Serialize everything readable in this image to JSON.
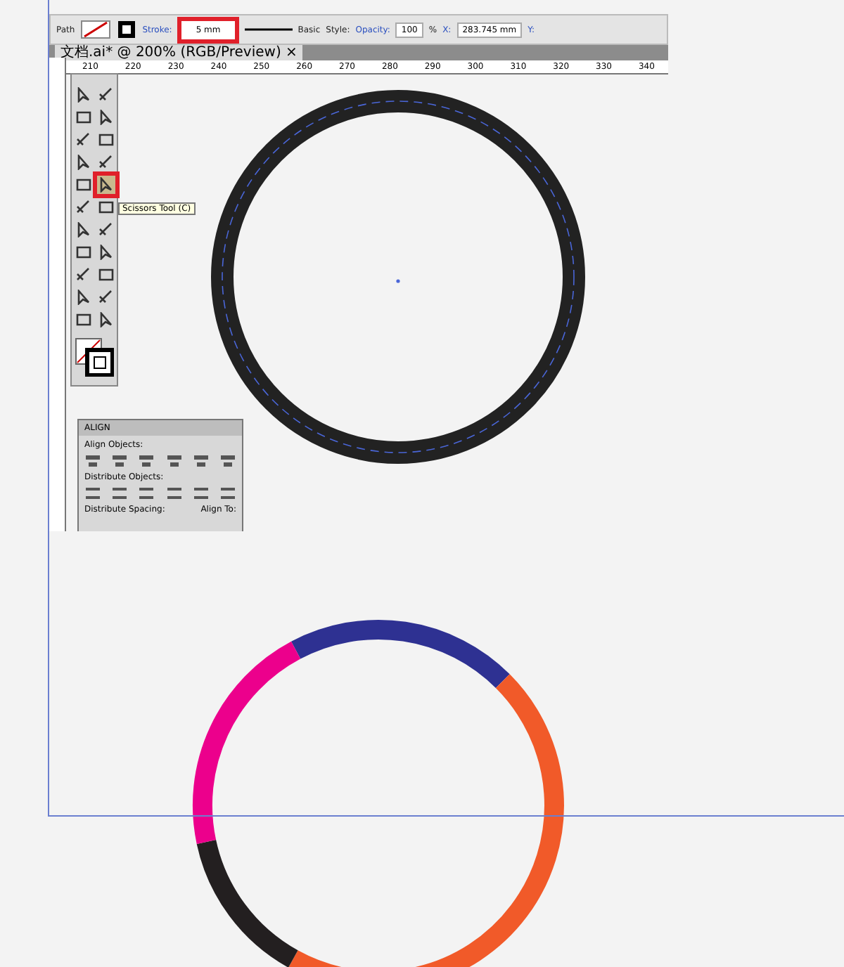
{
  "control_bar": {
    "selection": "Path",
    "stroke_label": "Stroke:",
    "stroke_weight": "5 mm",
    "stroke_highlighted": true,
    "brush": "Basic",
    "style_label": "Style:",
    "opacity_label": "Opacity:",
    "opacity": "100",
    "percent": "%",
    "x_label": "X:",
    "x_value": "283.745 mm",
    "y_label": "Y:"
  },
  "document_tab": {
    "title": "文档.ai* @ 200% (RGB/Preview)",
    "close": "×"
  },
  "ruler_marks": [
    "210",
    "220",
    "230",
    "240",
    "250",
    "260",
    "270",
    "280",
    "290",
    "300",
    "310",
    "320",
    "330",
    "340"
  ],
  "tools": [
    {
      "highlighted": false
    },
    {
      "highlighted": false
    },
    {
      "highlighted": false
    },
    {
      "highlighted": false
    },
    {
      "highlighted": false
    },
    {
      "highlighted": false
    },
    {
      "highlighted": false
    },
    {
      "highlighted": false
    },
    {
      "highlighted": false
    },
    {
      "highlighted": true
    },
    {
      "highlighted": false
    },
    {
      "highlighted": false
    },
    {
      "highlighted": false
    },
    {
      "highlighted": false
    },
    {
      "highlighted": false
    },
    {
      "highlighted": false
    },
    {
      "highlighted": false
    },
    {
      "highlighted": false
    },
    {
      "highlighted": false
    },
    {
      "highlighted": false
    },
    {
      "highlighted": false
    },
    {
      "highlighted": false
    }
  ],
  "tooltip": "Scissors Tool (C)",
  "align_panel": {
    "title": "ALIGN",
    "align_objects": "Align Objects:",
    "distribute_objects": "Distribute Objects:",
    "distribute_spacing": "Distribute Spacing:",
    "align_to": "Align To:"
  },
  "ring_segments": [
    {
      "color": "#2e3192"
    },
    {
      "color": "#f15a29"
    },
    {
      "color": "#231f20"
    },
    {
      "color": "#ec008c"
    }
  ]
}
